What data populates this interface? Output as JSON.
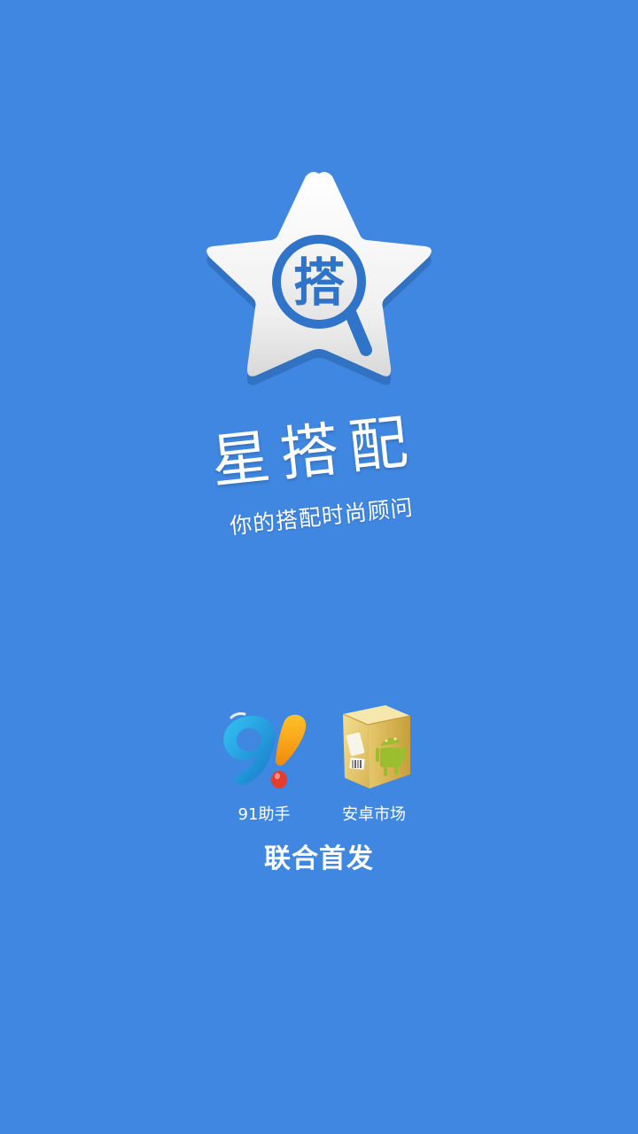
{
  "logo": {
    "char": "搭",
    "icon": "star-magnifier-icon"
  },
  "brand": {
    "app_name": "星搭配",
    "slogan": "你的搭配时尚顾问"
  },
  "partners": [
    {
      "label": "91助手",
      "icon": "91-assistant-icon"
    },
    {
      "label": "安卓市场",
      "icon": "android-market-icon"
    }
  ],
  "launch_text": "联合首发",
  "colors": {
    "background": "#3f87e1",
    "logo_blue": "#2f74c9",
    "text": "#ffffff"
  }
}
